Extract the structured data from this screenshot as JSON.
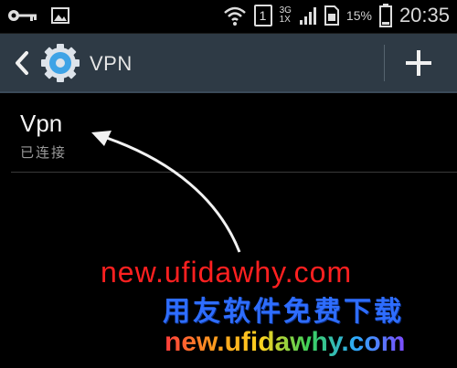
{
  "status_bar": {
    "time": "20:35",
    "battery_percent": "15%",
    "sim_slot": "1",
    "network_top": "3G",
    "network_bottom": "1X"
  },
  "action_bar": {
    "title": "VPN",
    "add_label": "+"
  },
  "vpn_list": [
    {
      "name": "Vpn",
      "status": "已连接"
    }
  ],
  "watermark": {
    "line1": "new.ufidawhy.com",
    "line2": "用友软件免费下载",
    "line3": "new.ufidawhy.com"
  },
  "colors": {
    "action_bar_bg": "#2e3a45",
    "accent_blue": "#3ea3e6",
    "watermark_red": "#ff2020",
    "watermark_blue": "#2e6dff"
  }
}
